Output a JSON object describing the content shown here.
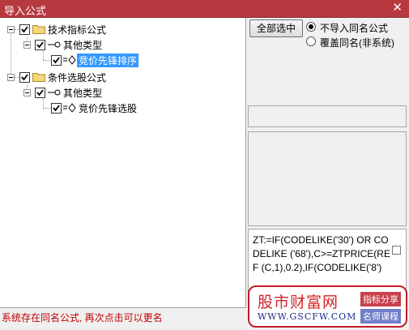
{
  "window": {
    "title": "导入公式",
    "close_icon": "close-icon"
  },
  "tree": {
    "nodes": [
      {
        "label": "技术指标公式",
        "icon": "folder-icon"
      },
      {
        "label": "其他类型",
        "icon": "key-icon"
      },
      {
        "label": "竞价先锋排序",
        "icon": "formula-icon",
        "selected": true
      },
      {
        "label": "条件选股公式",
        "icon": "folder-icon"
      },
      {
        "label": "其他类型",
        "icon": "key-icon"
      },
      {
        "label": "竞价先锋选股",
        "icon": "formula-icon"
      }
    ]
  },
  "options": {
    "select_all_button": "全部选中",
    "radio_no_import": "不导入同名公式",
    "radio_overwrite": "覆盖同名(非系统)"
  },
  "code": {
    "text": "ZT:=IF(CODELIKE('30') OR CODELIKE ('68'),C>=ZTPRICE(REF (C,1),0.2),IF(CODELIKE('8')"
  },
  "status": "系统存在同名公式, 再次点击可以更名",
  "watermark": {
    "title": "股市财富网",
    "url": "WWW.GSCFW.COM",
    "badge1": "指标分享",
    "badge2": "名师课程"
  },
  "colors": {
    "titlebar": "#b7393f",
    "selection": "#3399ff",
    "status": "#c00000"
  }
}
